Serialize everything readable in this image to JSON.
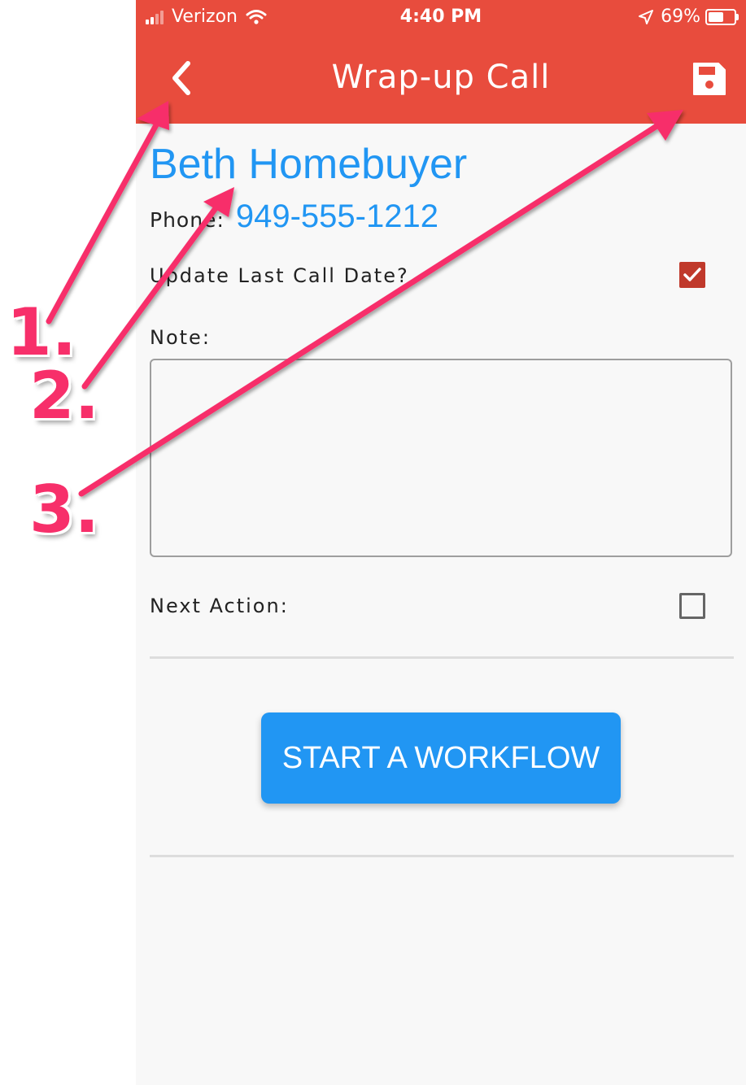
{
  "status_bar": {
    "carrier": "Verizon",
    "time": "4:40 PM",
    "battery": "69%",
    "battery_level": 0.69
  },
  "app_bar": {
    "title": "Wrap-up Call",
    "back_icon": "chevron-left-icon",
    "save_icon": "floppy-disk-icon"
  },
  "contact": {
    "name": "Beth Homebuyer",
    "phone_label": "Phone:",
    "phone_number": "949-555-1212"
  },
  "form": {
    "update_last_call_label": "Update Last Call Date?",
    "update_last_call_checked": true,
    "note_label": "Note:",
    "note_value": "",
    "next_action_label": "Next Action:",
    "next_action_checked": false,
    "start_workflow_label": "START A WORKFLOW"
  },
  "annotations": {
    "step1": "1.",
    "step2": "2.",
    "step3": "3."
  },
  "colors": {
    "header": "#e84c3d",
    "link": "#2196f3",
    "checkbox": "#c0392b",
    "annotation": "#f72f6a"
  }
}
